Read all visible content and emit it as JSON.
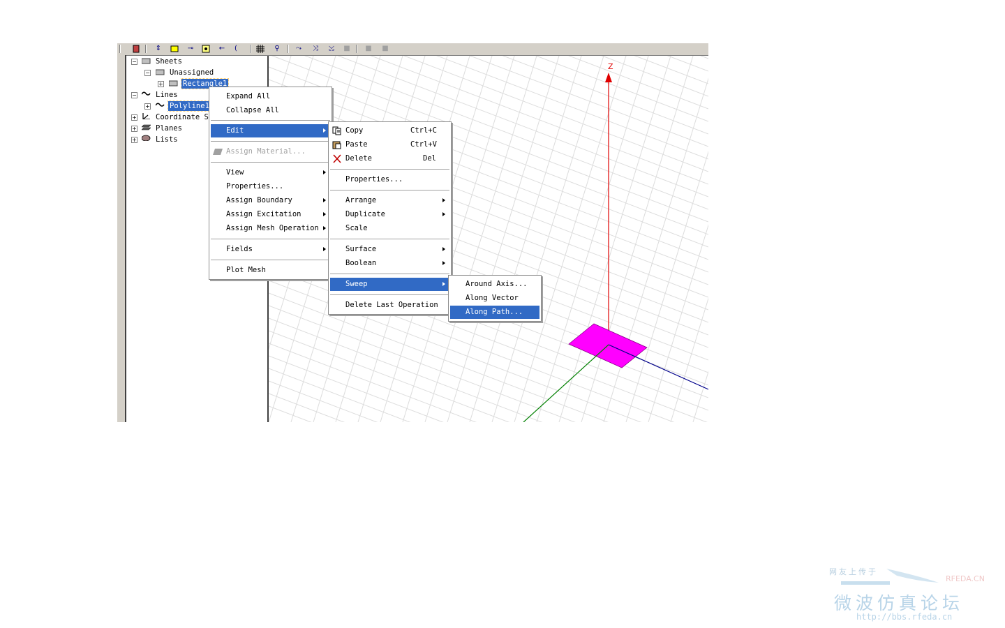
{
  "tree": {
    "sheets": "Sheets",
    "unassigned": "Unassigned",
    "rectangle": "Rectangle1",
    "lines": "Lines",
    "polyline": "Polyline1",
    "coord": "Coordinate Sy",
    "planes": "Planes",
    "lists": "Lists"
  },
  "context_menu": {
    "expand_all": "Expand All",
    "collapse_all": "Collapse All",
    "edit": "Edit",
    "assign_material": "Assign Material...",
    "view": "View",
    "properties": "Properties...",
    "assign_boundary": "Assign Boundary",
    "assign_excitation": "Assign Excitation",
    "assign_mesh": "Assign Mesh Operation",
    "fields": "Fields",
    "plot_mesh": "Plot Mesh"
  },
  "edit_menu": {
    "copy": "Copy",
    "copy_sc": "Ctrl+C",
    "paste": "Paste",
    "paste_sc": "Ctrl+V",
    "delete": "Delete",
    "delete_sc": "Del",
    "properties": "Properties...",
    "arrange": "Arrange",
    "duplicate": "Duplicate",
    "scale": "Scale",
    "surface": "Surface",
    "boolean": "Boolean",
    "sweep": "Sweep",
    "delete_last": "Delete Last Operation"
  },
  "sweep_menu": {
    "around_axis": "Around Axis...",
    "along_vector": "Along Vector",
    "along_path": "Along Path..."
  },
  "viewport": {
    "z_label": "Z",
    "shape_color": "#ff00ff",
    "z_axis_color": "#e00000",
    "x_axis_color": "#00008b",
    "y_axis_color": "#008000"
  },
  "watermark": {
    "tag": "网友上传于",
    "brand": "RFEDA.CN",
    "title": "微波仿真论坛",
    "url": "http://bbs.rfeda.cn"
  },
  "icons": [
    "copy-icon",
    "paste-icon",
    "delete-icon",
    "assign-material-icon",
    "sheet-icon",
    "line-icon",
    "coordinate-icon",
    "planes-icon",
    "lists-icon"
  ]
}
